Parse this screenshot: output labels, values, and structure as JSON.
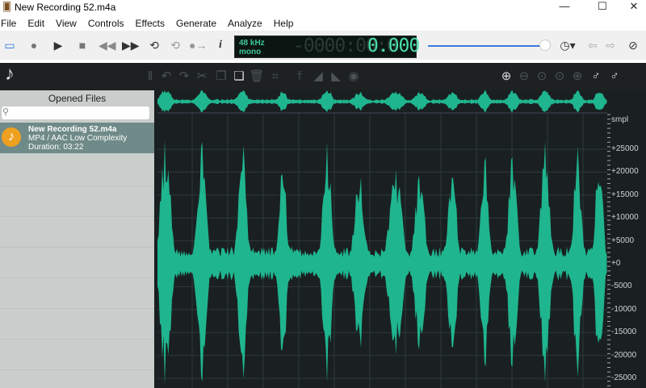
{
  "window": {
    "title": "New Recording 52.m4a",
    "minimize": "—",
    "maximize": "☐",
    "close": "✕"
  },
  "menu": [
    "File",
    "Edit",
    "View",
    "Controls",
    "Effects",
    "Generate",
    "Analyze",
    "Help"
  ],
  "transport": {
    "sample_rate": "48 kHz",
    "channels": "mono",
    "time_dim": "-0000:00:0",
    "time": "0.000",
    "volume_fraction": 0.95
  },
  "panel": {
    "title": "Opened Files",
    "search_placeholder": "",
    "file": {
      "name": "New Recording 52.m4a",
      "format": "MP4 / AAC Low Complexity",
      "duration": "Duration: 03:22"
    }
  },
  "axis": {
    "unit": "smpl",
    "ticks": [
      "+25000",
      "+20000",
      "+15000",
      "+10000",
      "+5000",
      "+0",
      "-5000",
      "-10000",
      "-15000",
      "-20000",
      "-25000"
    ]
  },
  "colors": {
    "waveform": "#1fb58f",
    "background": "#1a2021",
    "lcd": "#48e0a8"
  }
}
